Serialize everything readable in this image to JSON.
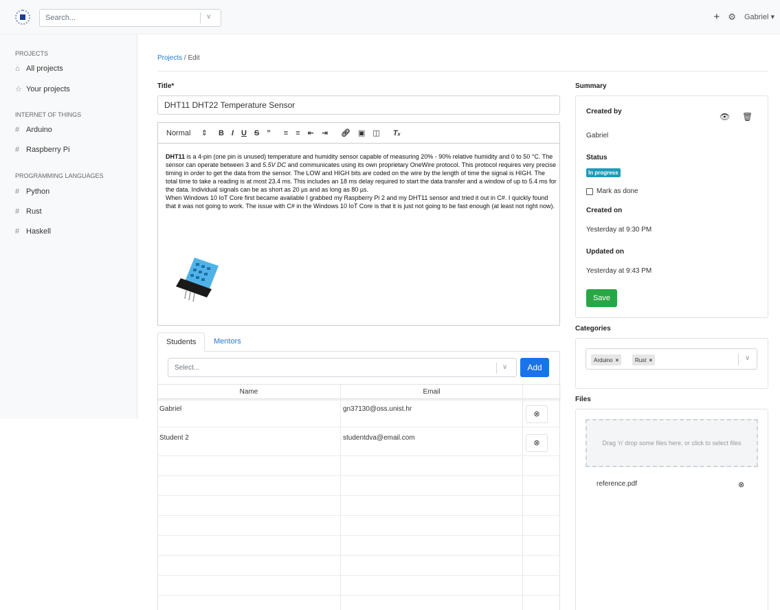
{
  "topbar": {
    "search_placeholder": "Search...",
    "user_name": "Gabriel",
    "add_icon": "plus-icon",
    "settings_icon": "gear-icon"
  },
  "sidebar": {
    "sections": [
      {
        "title": "PROJECTS",
        "items": [
          {
            "label": "All projects",
            "icon": "home-icon"
          },
          {
            "label": "Your projects",
            "icon": "star-icon"
          }
        ]
      },
      {
        "title": "INTERNET OF THINGS",
        "items": [
          {
            "label": "Arduino",
            "icon": "hash-icon"
          },
          {
            "label": "Raspberry Pi",
            "icon": "hash-icon"
          }
        ]
      },
      {
        "title": "PROGRAMMING LANGUAGES",
        "items": [
          {
            "label": "Python",
            "icon": "hash-icon"
          },
          {
            "label": "Rust",
            "icon": "hash-icon"
          },
          {
            "label": "Haskell",
            "icon": "hash-icon"
          }
        ]
      }
    ]
  },
  "breadcrumb": {
    "parent": "Projects",
    "separator": "/",
    "current": "Edit"
  },
  "form": {
    "title_label": "Title*",
    "title_value": "DHT11 DHT22 Temperature Sensor",
    "toolbar": {
      "format": "Normal",
      "format_arrow": "↕"
    },
    "content": {
      "p1_bold": "DHT11",
      "p1_rest": " is a 4-pin (one pin is unused) temperature and humidity sensor capable of measuring 20% - 90% relative humidity and 0 to 50 °C. The sensor can operate between 3 and ",
      "p1_italic": "5.5V DC",
      "p1_end": " and communicates using its own proprietary OneWire protocol. This protocol requires very precise timing in order to get the data from the sensor. The LOW and HIGH bits are coded on the wire by the length of time the signal is HIGH. The total time to take a reading is at most 23.4 ms. This includes an 18 ms delay required to start the data transfer and a window of up to 5.4 ms for the data. Individual signals can be as short as 20 µs and as long as 80 µs.",
      "p2": "When Windows 10 IoT Core first became available I grabbed my Raspberry Pi 2 and my DHT11 sensor and tried it out in C#. I quickly found that it was not going to work. The issue with C# in the Windows 10 IoT Core is that it is just not going to be fast enough (at least not right now)."
    }
  },
  "tabs": [
    {
      "label": "Students"
    },
    {
      "label": "Mentors"
    }
  ],
  "students": {
    "select_placeholder": "Select...",
    "add_label": "Add",
    "columns": [
      "Name",
      "Email"
    ],
    "rows": [
      {
        "name": "Gabriel",
        "email": "gn37130@oss.unist.hr"
      },
      {
        "name": "Student 2",
        "email": "studentdva@email.com"
      }
    ]
  },
  "summary": {
    "title": "Summary",
    "created_by_label": "Created by",
    "created_by": "Gabriel",
    "status_label": "Status",
    "status": "In progress",
    "mark_done": "Mark as done",
    "created_on_label": "Created on",
    "created_on": "Yesterday at 9:30 PM",
    "updated_on_label": "Updated on",
    "updated_on": "Yesterday at 9:43 PM",
    "save_label": "Save"
  },
  "categories": {
    "title": "Categories",
    "selected": [
      "Arduino",
      "Rust"
    ]
  },
  "files": {
    "title": "Files",
    "dropzone_text": "Drag 'n' drop some files here, or click to select files",
    "items": [
      {
        "name": "reference.pdf"
      }
    ]
  },
  "colors": {
    "primary": "#1a73e8",
    "success": "#28a745",
    "badge": "#1e9cb7",
    "link": "#1c7bd9"
  }
}
